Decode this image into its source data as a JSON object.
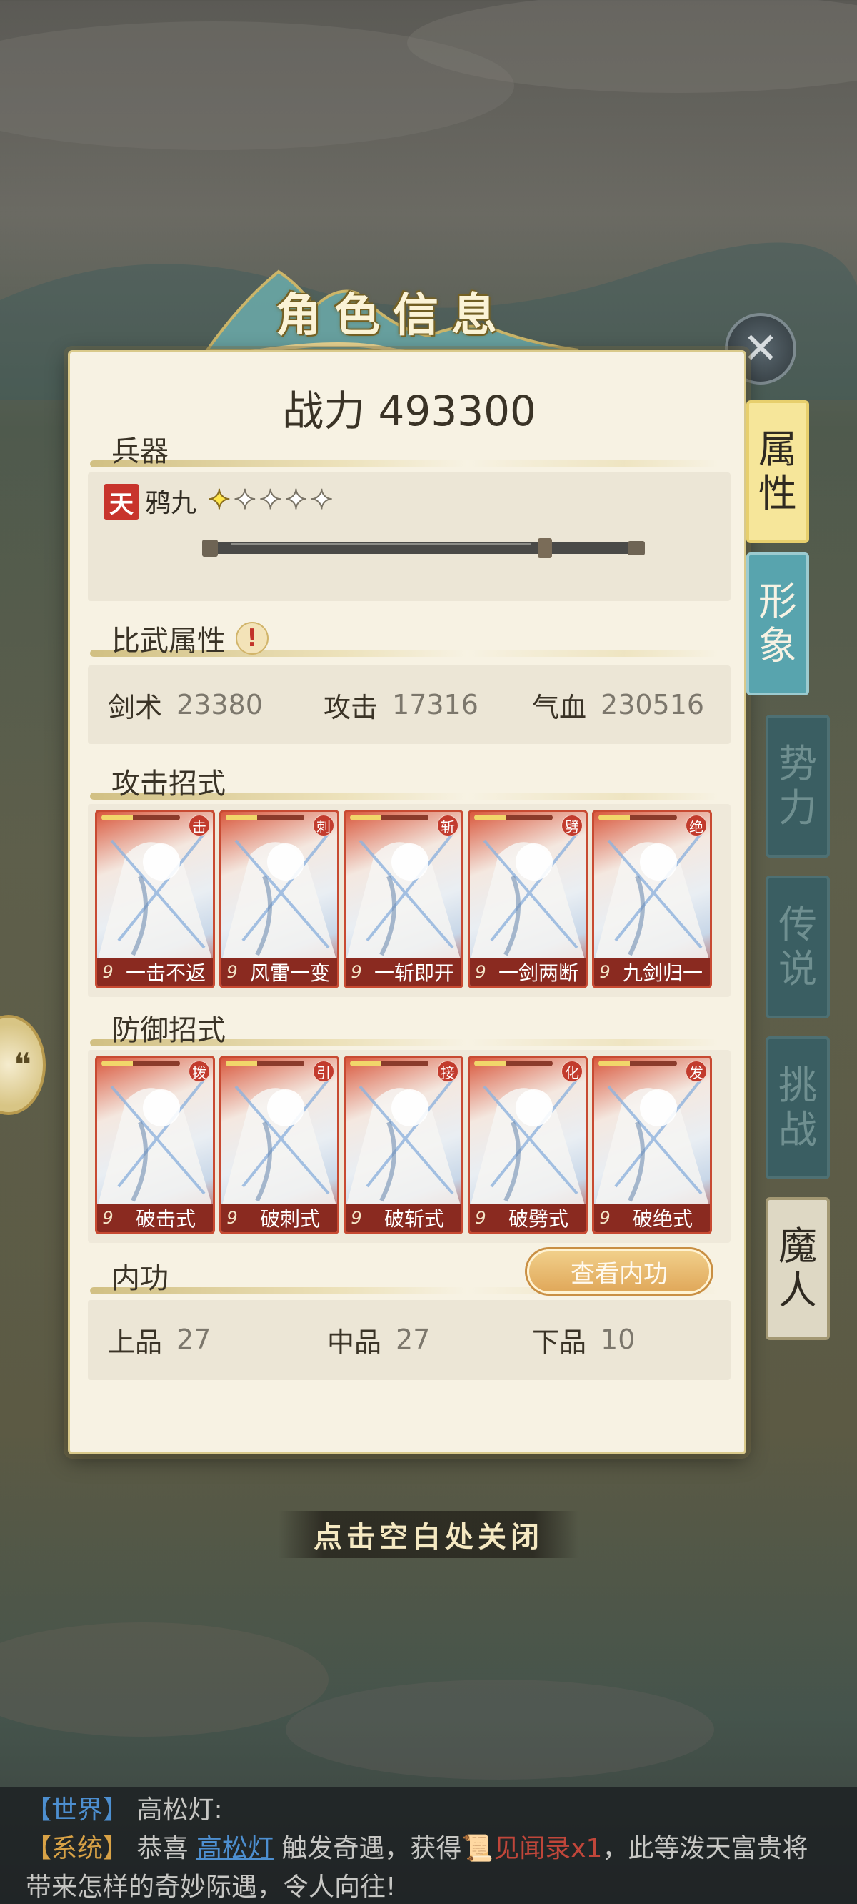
{
  "title": "角色信息",
  "close_hint": "点击空白处关闭",
  "power": {
    "label": "战力",
    "value": "493300"
  },
  "weapon": {
    "section_title": "兵器",
    "rank": "天",
    "name": "鸦九",
    "stars_filled": 1,
    "stars_total": 5
  },
  "combat_attrs": {
    "section_title": "比武属性",
    "alert_icon": "exclamation-icon",
    "stats": [
      {
        "label": "剑术",
        "value": "23380"
      },
      {
        "label": "攻击",
        "value": "17316"
      },
      {
        "label": "气血",
        "value": "230516"
      }
    ]
  },
  "attack_moves": {
    "section_title": "攻击招式",
    "cards": [
      {
        "badge": "击",
        "level": "9",
        "name": "一击不返"
      },
      {
        "badge": "刺",
        "level": "9",
        "name": "风雷一变"
      },
      {
        "badge": "斩",
        "level": "9",
        "name": "一斩即开"
      },
      {
        "badge": "劈",
        "level": "9",
        "name": "一剑两断"
      },
      {
        "badge": "绝",
        "level": "9",
        "name": "九剑归一"
      }
    ]
  },
  "defense_moves": {
    "section_title": "防御招式",
    "cards": [
      {
        "badge": "拨",
        "level": "9",
        "name": "破击式"
      },
      {
        "badge": "引",
        "level": "9",
        "name": "破刺式"
      },
      {
        "badge": "接",
        "level": "9",
        "name": "破斩式"
      },
      {
        "badge": "化",
        "level": "9",
        "name": "破劈式"
      },
      {
        "badge": "发",
        "level": "9",
        "name": "破绝式"
      }
    ]
  },
  "inner_power": {
    "section_title": "内功",
    "view_button": "查看内功",
    "stats": [
      {
        "label": "上品",
        "value": "27"
      },
      {
        "label": "中品",
        "value": "27"
      },
      {
        "label": "下品",
        "value": "10"
      }
    ]
  },
  "tabs": [
    {
      "label": "属性",
      "state": "active"
    },
    {
      "label": "形象",
      "state": "alt"
    },
    {
      "label": "势力",
      "state": "dim"
    },
    {
      "label": "传说",
      "state": "dim"
    },
    {
      "label": "挑战",
      "state": "dim"
    },
    {
      "label": "魔人",
      "state": "dark"
    }
  ],
  "chat": {
    "line1": {
      "channel": "【世界】",
      "text": "高松灯:"
    },
    "line2": {
      "channel": "【系统】",
      "prefix": "恭喜",
      "player": "高松灯",
      "middle": "触发奇遇，获得",
      "item": "见闻录x1",
      "suffix": "，此等泼天富贵将"
    },
    "line3": "带来怎样的奇妙际遇，令人向往!"
  },
  "colors": {
    "panel_bg": "#f7f2e3",
    "card_red": "#c84a32",
    "tab_active": "#f6e69a",
    "tab_alt": "#58a4ae",
    "world_channel": "#4d8fd0",
    "system_channel": "#d8a246"
  }
}
